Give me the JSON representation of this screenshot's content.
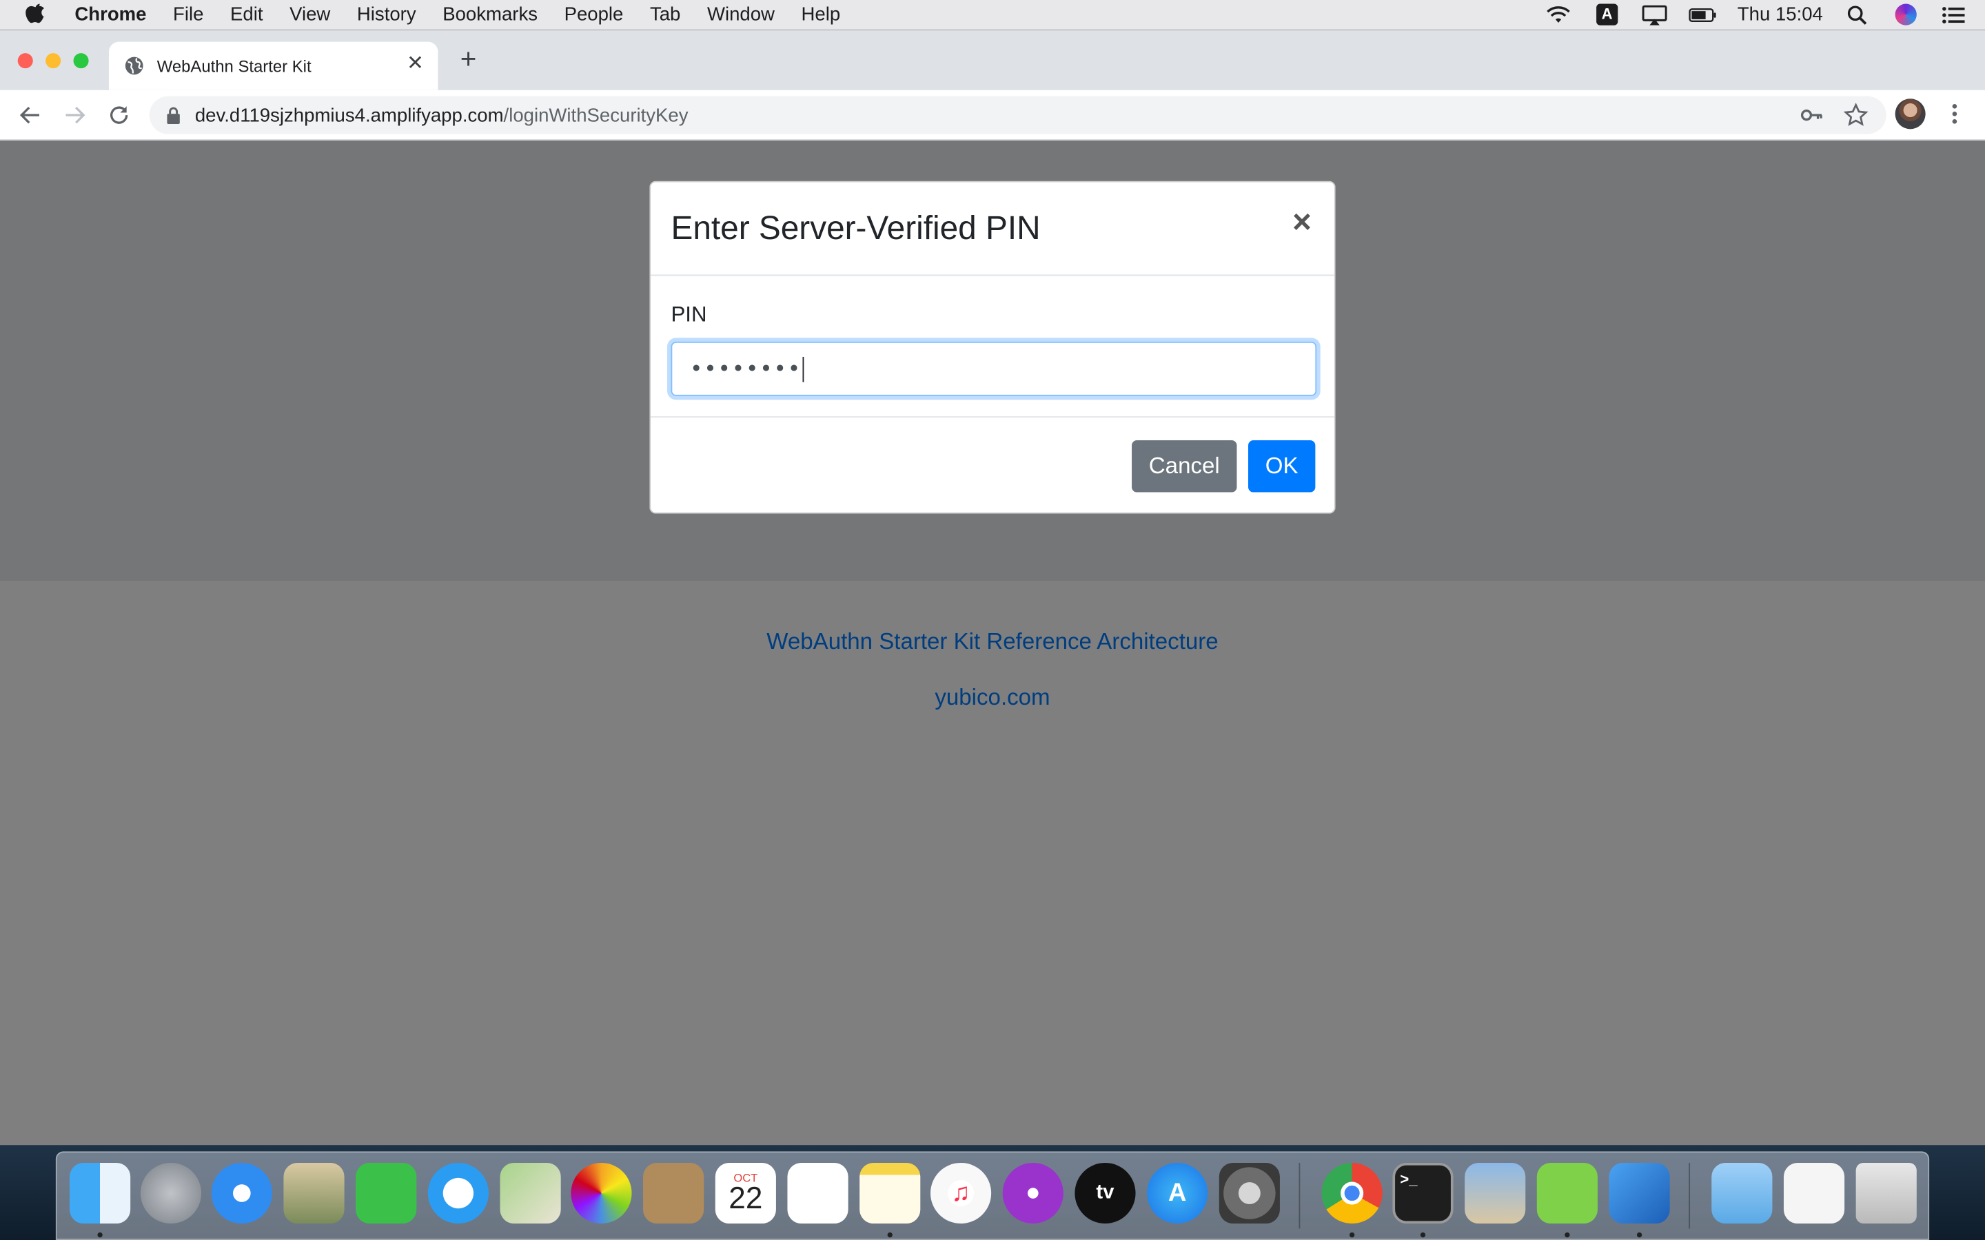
{
  "menubar": {
    "app_name": "Chrome",
    "items": [
      "File",
      "Edit",
      "View",
      "History",
      "Bookmarks",
      "People",
      "Tab",
      "Window",
      "Help"
    ],
    "input_source": "A",
    "clock": "Thu 15:04"
  },
  "browser": {
    "tab_title": "WebAuthn Starter Kit",
    "url_host": "dev.d119sjzhpmius4.amplifyapp.com",
    "url_path": "/loginWithSecurityKey"
  },
  "page": {
    "footer_links": [
      "WebAuthn Starter Kit Reference Architecture",
      "yubico.com"
    ]
  },
  "modal": {
    "title": "Enter Server-Verified PIN",
    "close_symbol": "×",
    "pin_label": "PIN",
    "pin_value_masked": "••••••••",
    "cancel_label": "Cancel",
    "ok_label": "OK"
  },
  "dock": {
    "apps": [
      "finder-icon",
      "launchpad-icon",
      "safari-icon",
      "mail-icon",
      "facetime-icon",
      "messages-icon",
      "maps-icon",
      "photos-icon",
      "contacts-icon",
      "calendar-icon",
      "reminders-icon",
      "notes-icon",
      "music-icon",
      "podcasts-icon",
      "tv-icon",
      "app-store-icon",
      "system-preferences-icon",
      "chrome-icon",
      "terminal-icon",
      "preview-icon",
      "archive-utility-icon",
      "xcode-icon",
      "downloads-folder-icon",
      "documents-stack-icon",
      "trash-icon"
    ],
    "calendar_month": "OCT",
    "calendar_day": "22",
    "tv_label": "tv"
  },
  "colors": {
    "primary": "#007bff",
    "secondary": "#6c757d",
    "overlay": "rgba(0,0,0,0.5)"
  }
}
